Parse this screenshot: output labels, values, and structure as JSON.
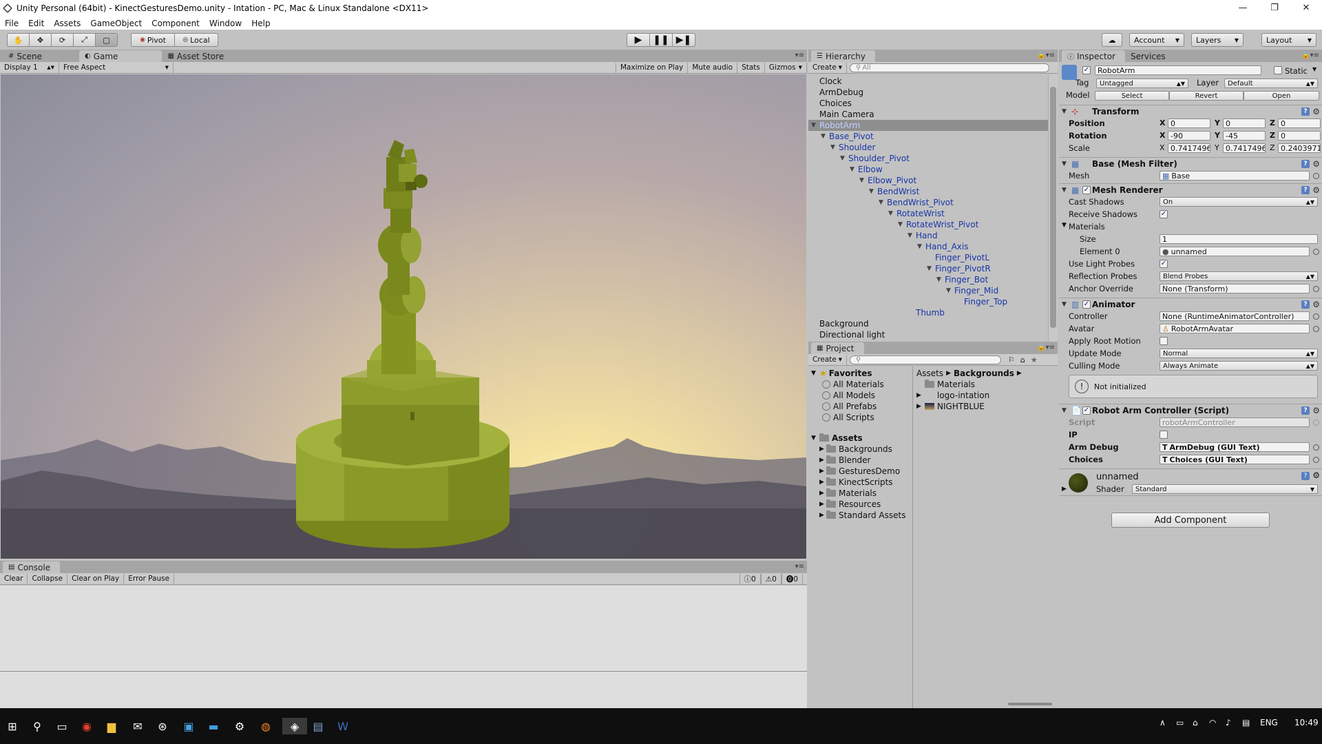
{
  "window": {
    "title": "Unity Personal (64bit) - KinectGesturesDemo.unity - Intation - PC, Mac & Linux Standalone <DX11>",
    "controls": [
      "—",
      "❐",
      "✕"
    ]
  },
  "menu": [
    "File",
    "Edit",
    "Assets",
    "GameObject",
    "Component",
    "Window",
    "Help"
  ],
  "toolbar": {
    "tools": [
      "✋",
      "✥",
      "⟳",
      "⤢",
      "▢"
    ],
    "pivot_label": "Pivot",
    "local_label": "Local",
    "play": [
      "▶",
      "❚❚",
      "▶❚"
    ],
    "cloud_icon": "☁",
    "account_label": "Account",
    "layers_label": "Layers",
    "layout_label": "Layout"
  },
  "game_panel": {
    "tabs": [
      {
        "label": "Scene",
        "icon": "#"
      },
      {
        "label": "Game",
        "icon": "◐"
      },
      {
        "label": "Asset Store",
        "icon": "▦"
      }
    ],
    "display": "Display 1",
    "aspect": "Free Aspect",
    "options": [
      "Maximize on Play",
      "Mute audio",
      "Stats",
      "Gizmos"
    ]
  },
  "console_panel": {
    "tab": "Console",
    "buttons": [
      "Clear",
      "Collapse",
      "Clear on Play",
      "Error Pause"
    ],
    "counts": {
      "info": "0",
      "warn": "0",
      "error": "0"
    }
  },
  "hierarchy_panel": {
    "tab": "Hierarchy",
    "create": "Create",
    "search_placeholder": "All",
    "items": [
      {
        "label": "Clock",
        "depth": 0,
        "arrow": ""
      },
      {
        "label": "ArmDebug",
        "depth": 0,
        "arrow": ""
      },
      {
        "label": "Choices",
        "depth": 0,
        "arrow": ""
      },
      {
        "label": "Main Camera",
        "depth": 0,
        "arrow": ""
      },
      {
        "label": "RobotArm",
        "depth": 0,
        "arrow": "▼",
        "selected": true,
        "prefab": true
      },
      {
        "label": "Base_Pivot",
        "depth": 1,
        "arrow": "▼",
        "prefab": true
      },
      {
        "label": "Shoulder",
        "depth": 2,
        "arrow": "▼",
        "prefab": true
      },
      {
        "label": "Shoulder_Pivot",
        "depth": 3,
        "arrow": "▼",
        "prefab": true
      },
      {
        "label": "Elbow",
        "depth": 4,
        "arrow": "▼",
        "prefab": true
      },
      {
        "label": "Elbow_Pivot",
        "depth": 5,
        "arrow": "▼",
        "prefab": true
      },
      {
        "label": "BendWrist",
        "depth": 6,
        "arrow": "▼",
        "prefab": true
      },
      {
        "label": "BendWrist_Pivot",
        "depth": 7,
        "arrow": "▼",
        "prefab": true
      },
      {
        "label": "RotateWrist",
        "depth": 8,
        "arrow": "▼",
        "prefab": true
      },
      {
        "label": "RotateWrist_Pivot",
        "depth": 9,
        "arrow": "▼",
        "prefab": true
      },
      {
        "label": "Hand",
        "depth": 10,
        "arrow": "▼",
        "prefab": true
      },
      {
        "label": "Hand_Axis",
        "depth": 11,
        "arrow": "▼",
        "prefab": true
      },
      {
        "label": "Finger_PivotL",
        "depth": 12,
        "arrow": "",
        "prefab": true
      },
      {
        "label": "Finger_PivotR",
        "depth": 12,
        "arrow": "▼",
        "prefab": true
      },
      {
        "label": "Finger_Bot",
        "depth": 13,
        "arrow": "▼",
        "prefab": true
      },
      {
        "label": "Finger_Mid",
        "depth": 14,
        "arrow": "▼",
        "prefab": true
      },
      {
        "label": "Finger_Top",
        "depth": 15,
        "arrow": "",
        "prefab": true
      },
      {
        "label": "Thumb",
        "depth": 10,
        "arrow": "",
        "prefab": true
      },
      {
        "label": "Background",
        "depth": 0,
        "arrow": ""
      },
      {
        "label": "Directional light",
        "depth": 0,
        "arrow": ""
      }
    ]
  },
  "project_panel": {
    "tab": "Project",
    "create": "Create",
    "favorites_label": "Favorites",
    "favorites": [
      "All Materials",
      "All Models",
      "All Prefabs",
      "All Scripts"
    ],
    "assets_label": "Assets",
    "asset_folders": [
      "Backgrounds",
      "Blender",
      "GesturesDemo",
      "KinectScripts",
      "Materials",
      "Resources",
      "Standard Assets"
    ],
    "breadcrumb": [
      "Assets",
      "Backgrounds"
    ],
    "contents": [
      {
        "label": "Materials",
        "arrow": ""
      },
      {
        "label": "logo-intation",
        "arrow": "▶"
      },
      {
        "label": "NIGHTBLUE",
        "arrow": "▶"
      }
    ]
  },
  "inspector_panel": {
    "tabs": [
      "Inspector",
      "Services"
    ],
    "object_name": "RobotArm",
    "static_label": "Static",
    "tag_label": "Tag",
    "tag_value": "Untagged",
    "layer_label": "Layer",
    "layer_value": "Default",
    "model_label": "Model",
    "model_buttons": [
      "Select",
      "Revert",
      "Open"
    ],
    "transform": {
      "title": "Transform",
      "position_label": "Position",
      "rotation_label": "Rotation",
      "scale_label": "Scale",
      "position": [
        "0",
        "0",
        "0"
      ],
      "rotation": [
        "-90",
        "-45",
        "0"
      ],
      "scale": [
        "0.7417496",
        "0.7417496",
        "0.2403971"
      ]
    },
    "mesh_filter": {
      "title": "Base (Mesh Filter)",
      "mesh_label": "Mesh",
      "mesh_value": "Base"
    },
    "mesh_renderer": {
      "title": "Mesh Renderer",
      "cast_shadows_label": "Cast Shadows",
      "cast_shadows": "On",
      "receive_shadows_label": "Receive Shadows",
      "materials_label": "Materials",
      "size_label": "Size",
      "size": "1",
      "element0_label": "Element 0",
      "element0": "unnamed",
      "use_light_probes_label": "Use Light Probes",
      "reflection_probes_label": "Reflection Probes",
      "reflection_probes": "Blend Probes",
      "anchor_override_label": "Anchor Override",
      "anchor_override": "None (Transform)"
    },
    "animator": {
      "title": "Animator",
      "controller_label": "Controller",
      "controller": "None (RuntimeAnimatorController)",
      "avatar_label": "Avatar",
      "avatar": "RobotArmAvatar",
      "apply_root_motion_label": "Apply Root Motion",
      "update_mode_label": "Update Mode",
      "update_mode": "Normal",
      "culling_mode_label": "Culling Mode",
      "culling_mode": "Always Animate",
      "status": "Not initialized"
    },
    "script": {
      "title": "Robot Arm Controller (Script)",
      "script_label": "Script",
      "script_value": "robotArmController",
      "ip_label": "IP",
      "arm_debug_label": "Arm Debug",
      "arm_debug": "ArmDebug (GUI Text)",
      "choices_label": "Choices",
      "choices": "Choices (GUI Text)"
    },
    "material": {
      "name": "unnamed",
      "shader_label": "Shader",
      "shader": "Standard"
    },
    "add_component": "Add Component"
  },
  "taskbar": {
    "clock": "10:49",
    "language": "ENG"
  },
  "colors": {
    "editor_bg": "#c2c2c2",
    "selection": "#8e8e8e",
    "prefab_text": "#1835a8",
    "robot_green": "#8a9a2a"
  }
}
